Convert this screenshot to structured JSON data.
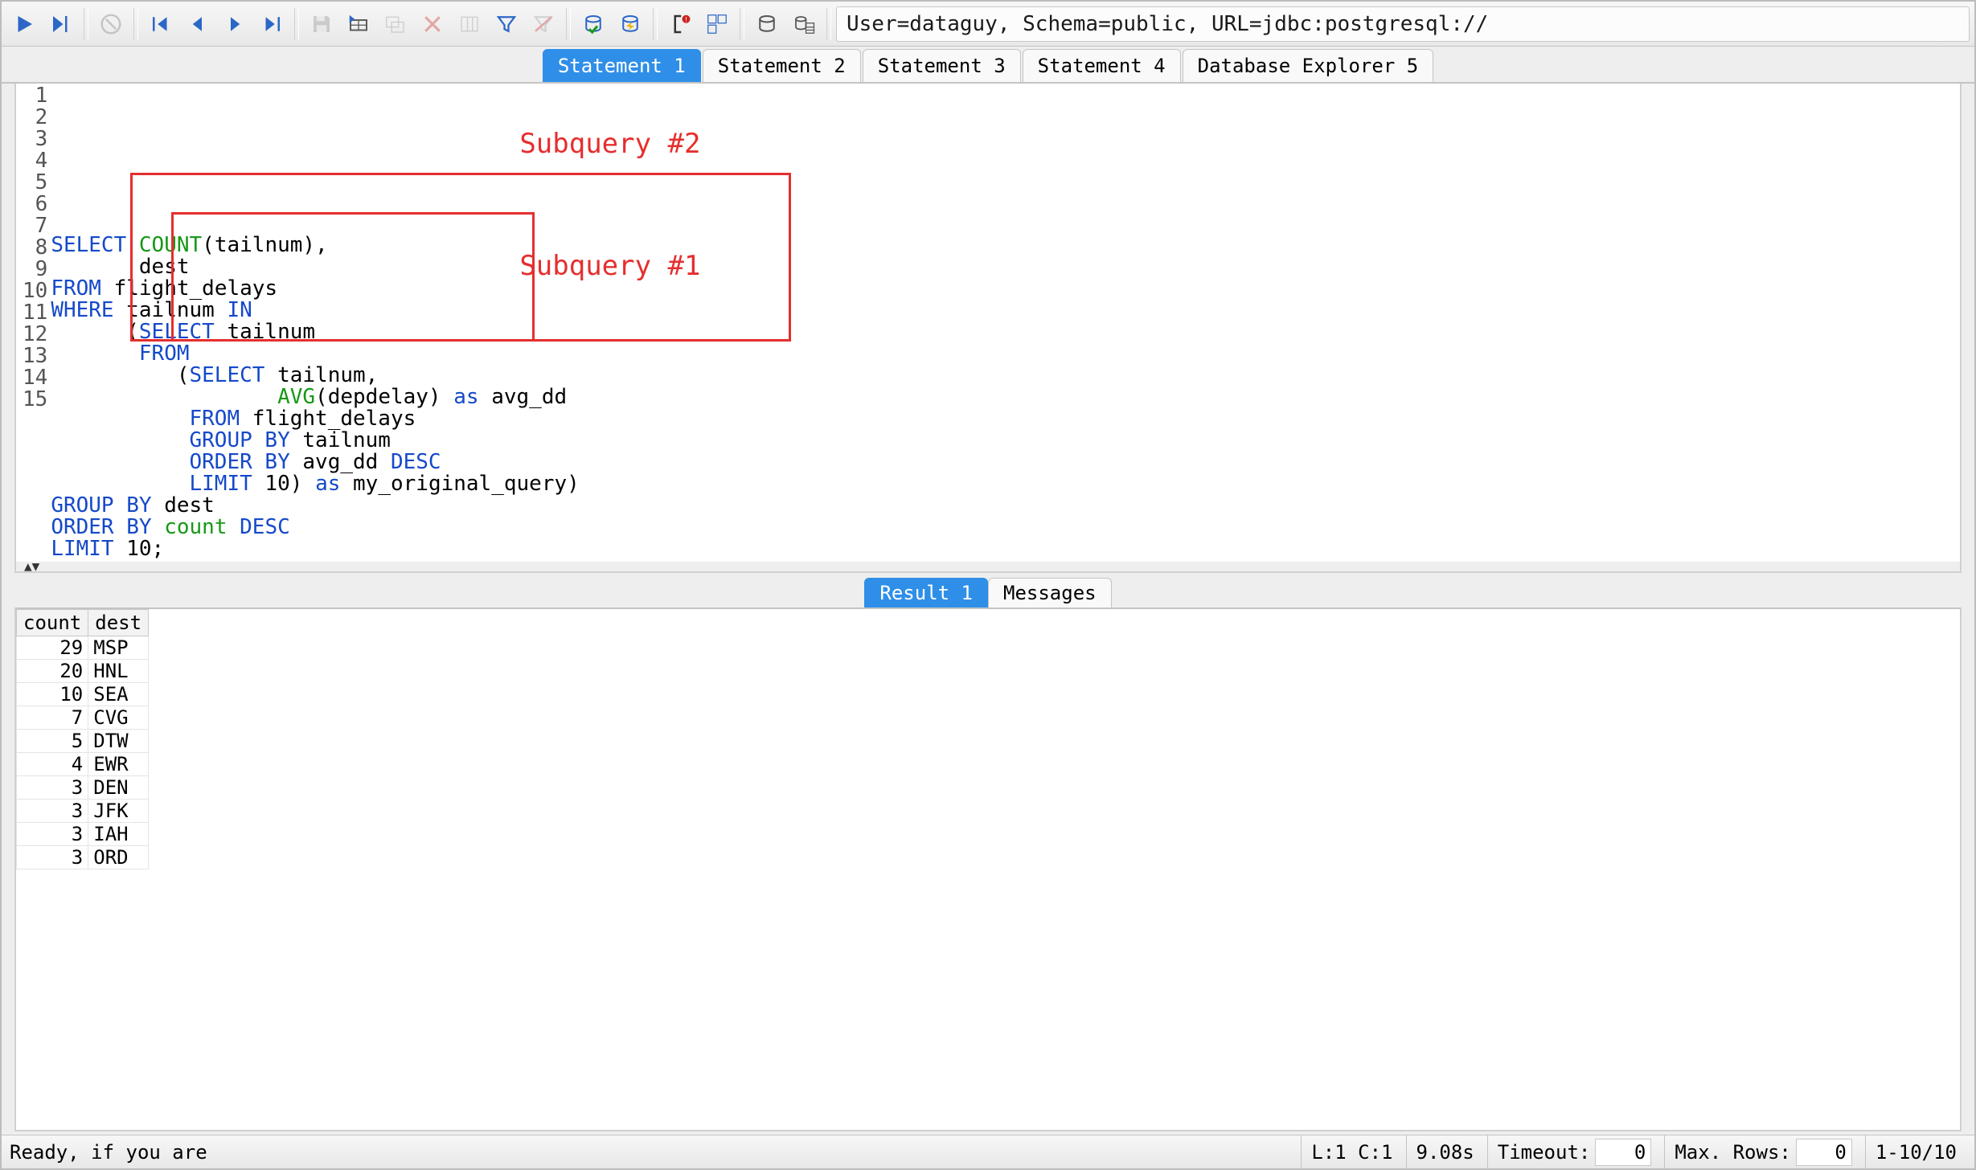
{
  "connection_info": "User=dataguy, Schema=public, URL=jdbc:postgresql://",
  "tabs": [
    {
      "label": "Statement 1",
      "active": true
    },
    {
      "label": "Statement 2",
      "active": false
    },
    {
      "label": "Statement 3",
      "active": false
    },
    {
      "label": "Statement 4",
      "active": false
    },
    {
      "label": "Database Explorer 5",
      "active": false
    }
  ],
  "code": {
    "lines": [
      [
        {
          "t": "SELECT",
          "c": "kw"
        },
        {
          "t": " "
        },
        {
          "t": "COUNT",
          "c": "fn"
        },
        {
          "t": "(tailnum),"
        }
      ],
      [
        {
          "t": "       dest"
        }
      ],
      [
        {
          "t": "FROM",
          "c": "kw"
        },
        {
          "t": " flight_delays"
        }
      ],
      [
        {
          "t": "WHERE",
          "c": "kw"
        },
        {
          "t": " tailnum "
        },
        {
          "t": "IN",
          "c": "kw"
        }
      ],
      [
        {
          "t": "      ("
        },
        {
          "t": "SELECT",
          "c": "kw"
        },
        {
          "t": " tailnum"
        }
      ],
      [
        {
          "t": "       "
        },
        {
          "t": "FROM",
          "c": "kw"
        }
      ],
      [
        {
          "t": "          ("
        },
        {
          "t": "SELECT",
          "c": "kw"
        },
        {
          "t": " tailnum,"
        }
      ],
      [
        {
          "t": "                  "
        },
        {
          "t": "AVG",
          "c": "fn"
        },
        {
          "t": "(depdelay) "
        },
        {
          "t": "as",
          "c": "kw"
        },
        {
          "t": " avg_dd"
        }
      ],
      [
        {
          "t": "           "
        },
        {
          "t": "FROM",
          "c": "kw"
        },
        {
          "t": " flight_delays"
        }
      ],
      [
        {
          "t": "           "
        },
        {
          "t": "GROUP BY",
          "c": "kw"
        },
        {
          "t": " tailnum"
        }
      ],
      [
        {
          "t": "           "
        },
        {
          "t": "ORDER BY",
          "c": "kw"
        },
        {
          "t": " avg_dd "
        },
        {
          "t": "DESC",
          "c": "kw"
        }
      ],
      [
        {
          "t": "           "
        },
        {
          "t": "LIMIT",
          "c": "kw"
        },
        {
          "t": " 10) "
        },
        {
          "t": "as",
          "c": "kw"
        },
        {
          "t": " my_original_query)"
        }
      ],
      [
        {
          "t": "GROUP BY",
          "c": "kw"
        },
        {
          "t": " dest"
        }
      ],
      [
        {
          "t": "ORDER BY",
          "c": "kw"
        },
        {
          "t": " "
        },
        {
          "t": "count",
          "c": "fn"
        },
        {
          "t": " "
        },
        {
          "t": "DESC",
          "c": "kw"
        }
      ],
      [
        {
          "t": "LIMIT",
          "c": "kw"
        },
        {
          "t": " 10;"
        }
      ]
    ]
  },
  "annotations": {
    "sub2_label": "Subquery #2",
    "sub1_label": "Subquery #1"
  },
  "result_tabs": [
    {
      "label": "Result 1",
      "active": true
    },
    {
      "label": "Messages",
      "active": false
    }
  ],
  "result": {
    "columns": [
      "count",
      "dest"
    ],
    "rows": [
      [
        "29",
        "MSP"
      ],
      [
        "20",
        "HNL"
      ],
      [
        "10",
        "SEA"
      ],
      [
        "7",
        "CVG"
      ],
      [
        "5",
        "DTW"
      ],
      [
        "4",
        "EWR"
      ],
      [
        "3",
        "DEN"
      ],
      [
        "3",
        "JFK"
      ],
      [
        "3",
        "IAH"
      ],
      [
        "3",
        "ORD"
      ]
    ]
  },
  "status": {
    "ready": "Ready, if you are",
    "cursor": "L:1 C:1",
    "time": "9.08s",
    "timeout_label": "Timeout:",
    "timeout_value": "0",
    "maxrows_label": "Max. Rows:",
    "maxrows_value": "0",
    "range": "1-10/10"
  }
}
